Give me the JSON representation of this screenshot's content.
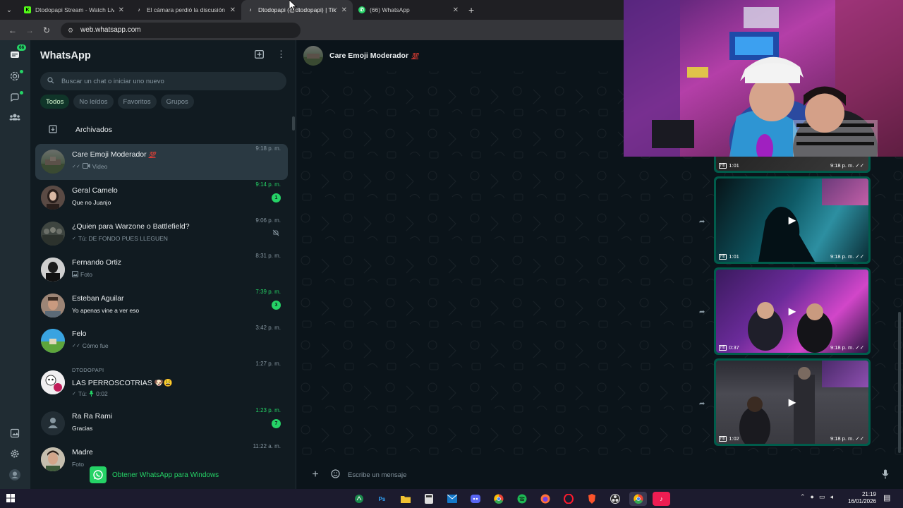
{
  "browser": {
    "tabs": [
      {
        "title": "Dtodopapi Stream - Watch Live",
        "icon": "kick-icon",
        "active": false
      },
      {
        "title": "El cámara perdió la discusión ja",
        "icon": "tiktok-icon",
        "active": false
      },
      {
        "title": "Dtodopapi (@dtodopapi) | TikT",
        "icon": "tiktok-icon",
        "active": true
      },
      {
        "title": "(66) WhatsApp",
        "icon": "whatsapp-icon",
        "active": false
      }
    ],
    "url": "web.whatsapp.com"
  },
  "rail": {
    "chats_badge": "66"
  },
  "chatlist": {
    "title": "WhatsApp",
    "search_placeholder": "Buscar un chat o iniciar uno nuevo",
    "filters": [
      "Todos",
      "No leídos",
      "Favoritos",
      "Grupos"
    ],
    "archived_label": "Archivados",
    "chats": [
      {
        "name": "Care Emoji Moderador",
        "tag": "💯",
        "preview": "Video",
        "time": "9:18 p. m.",
        "ticks": "✓✓",
        "kind": "video"
      },
      {
        "name": "Geral Camelo",
        "preview": "Que no Juanjo",
        "time": "9:14 p. m.",
        "unread": "1"
      },
      {
        "name": "¿Quien para Warzone o Battlefield?",
        "preview": "Tú: DE FONDO PUES LLEGUEN",
        "time": "9:06 p. m.",
        "ticks": "✓"
      },
      {
        "name": "Fernando Ortiz",
        "preview": "Foto",
        "time": "8:31 p. m.",
        "kind": "photo"
      },
      {
        "name": "Esteban Aguilar",
        "preview": "Yo apenas vine a ver eso",
        "time": "7:39 p. m.",
        "unread": "3"
      },
      {
        "name": "Felo",
        "preview": "Cómo fue",
        "time": "3:42 p. m.",
        "ticks": "✓✓"
      },
      {
        "group": "DTODOPAPI",
        "name": "LAS PERROSCOTRIAS 🐶😩",
        "preview": "Tú: ",
        "voice": "0:02",
        "time": "1:27 p. m.",
        "ticks": "✓"
      },
      {
        "name": "Ra Ra Rami",
        "preview": "Gracias",
        "time": "1:23 p. m.",
        "unread": "7"
      },
      {
        "name": "Madre",
        "preview": "Foto",
        "time": "11:22 a. m."
      }
    ],
    "get_windows": "Obtener WhatsApp para Windows"
  },
  "conversation": {
    "title": "Care Emoji Moderador",
    "tag": "💯",
    "composer_placeholder": "Escribe un mensaje",
    "videos": [
      {
        "duration": "1:01",
        "time": "9:18 p. m.",
        "ticks": "✓✓"
      },
      {
        "duration": "1:01",
        "time": "9:18 p. m.",
        "ticks": "✓✓"
      },
      {
        "duration": "0:37",
        "time": "9:18 p. m.",
        "ticks": "✓✓"
      },
      {
        "duration": "1:02",
        "time": "9:18 p. m.",
        "ticks": "✓✓"
      }
    ]
  },
  "taskbar": {
    "time": "21:19",
    "date": "16/01/2026",
    "apps": [
      "sourcetree-icon",
      "photoshop-icon",
      "folder-icon",
      "calculator-icon",
      "outlook-icon",
      "discord-icon",
      "chrome-icon",
      "spotify-icon",
      "firefox-icon",
      "opera-icon",
      "brave-icon",
      "obs-icon",
      "chrome-icon",
      "tiktok-icon"
    ],
    "labels": {
      "photoshop-icon": "Ps"
    }
  },
  "colors": {
    "accent": "#25d366",
    "panel": "#111b21",
    "bubble": "#005c4b"
  }
}
